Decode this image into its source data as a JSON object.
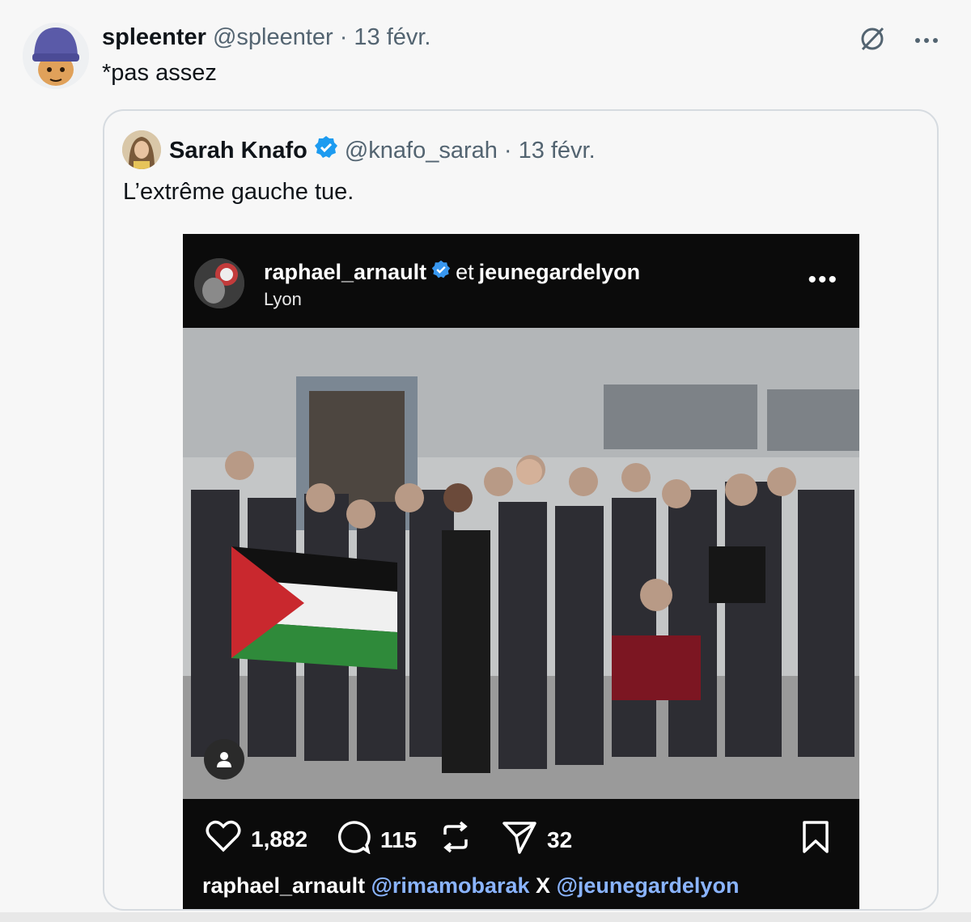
{
  "post": {
    "author_name": "spleenter",
    "author_handle": "@spleenter",
    "separator": "·",
    "date": "13 févr.",
    "text": "*pas assez",
    "icons": [
      "grok-icon",
      "more-icon"
    ]
  },
  "quote": {
    "author_name": "Sarah Knafo",
    "verified": true,
    "author_handle": "@knafo_sarah",
    "separator": "·",
    "date": "13 févr.",
    "text": "L’extrême gauche tue."
  },
  "instagram": {
    "account1": "raphael_arnault",
    "joiner": "et",
    "account2": "jeunegardelyon",
    "location": "Lyon",
    "more": "•••",
    "likes": "1,882",
    "comments": "115",
    "shares": "32",
    "caption_user": "raphael_arnault",
    "caption_tag1": "@rimamobarak",
    "caption_x": "X",
    "caption_tag2": "@jeunegardelyon"
  },
  "colors": {
    "verified_blue": "#1d9bf0",
    "ig_verified": "#3897f0",
    "muted": "#536471",
    "tag_blue": "#8ab4ff"
  }
}
